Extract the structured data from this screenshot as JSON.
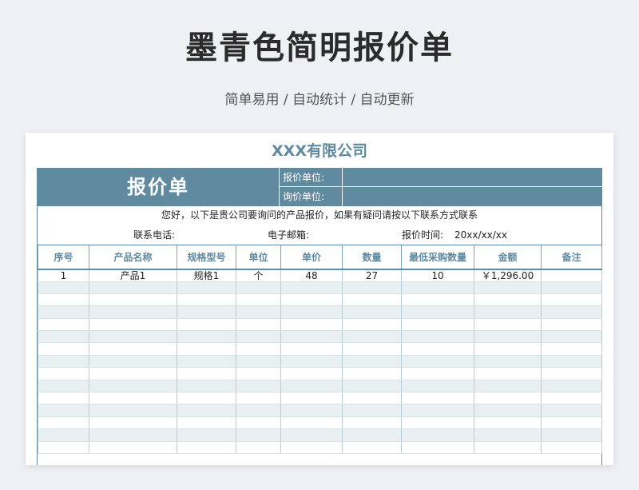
{
  "page": {
    "title": "墨青色简明报价单",
    "subtitle": "简单易用 / 自动统计 / 自动更新"
  },
  "sheet": {
    "company": "XXX有限公司",
    "quote_title": "报价单",
    "quote_unit_label": "报价单位:",
    "inquiry_unit_label": "询价单位:",
    "intro": "您好，以下是贵公司要询问的产品报价，如果有疑问请按以下联系方式联系",
    "phone_label": "联系电话:",
    "email_label": "电子邮箱:",
    "time_label": "报价时间:",
    "time_value": "20xx/xx/xx"
  },
  "table": {
    "columns": [
      "序号",
      "产品名称",
      "规格型号",
      "单位",
      "单价",
      "数量",
      "最低采购数量",
      "金额",
      "备注"
    ],
    "rows": [
      [
        "1",
        "产品1",
        "规格1",
        "个",
        "48",
        "27",
        "10",
        "￥1,296.00",
        ""
      ]
    ],
    "empty_rows": 14
  },
  "colors": {
    "accent": "#5f8aa0",
    "row_alt": "#e8f0f2"
  }
}
